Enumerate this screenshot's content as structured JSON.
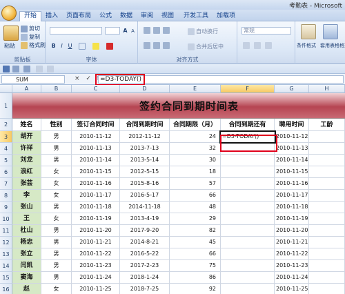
{
  "window": {
    "title": "考勤表 - Microsoft"
  },
  "tabs": [
    "开始",
    "插入",
    "页面布局",
    "公式",
    "数据",
    "审阅",
    "视图",
    "开发工具",
    "加载项"
  ],
  "ribbon": {
    "clipboard": {
      "paste": "粘贴",
      "cut": "剪切",
      "copy": "复制",
      "format_painter": "格式刷",
      "label": "剪贴板"
    },
    "font": {
      "label": "字体",
      "bold": "B",
      "italic": "I",
      "underline": "U",
      "grow": "A",
      "shrink": "A"
    },
    "alignment": {
      "label": "对齐方式",
      "wrap": "自动换行",
      "merge": "合并后居中"
    },
    "number": {
      "format": "常规"
    },
    "styles": {
      "conditional": "条件格式",
      "table": "套用表格格式"
    }
  },
  "formula_bar": {
    "name_box": "SUM",
    "fx": "× ✓ fx",
    "formula": "=D3-TODAY()"
  },
  "columns": [
    "A",
    "B",
    "C",
    "D",
    "E",
    "F",
    "G",
    "H"
  ],
  "sheet_title": "签约合同到期时间表",
  "headers": [
    "姓名",
    "性别",
    "签订合同时间",
    "合同到期时间",
    "合同期限（月）",
    "合同到期还有",
    "聘用时间",
    "工龄"
  ],
  "rows": [
    {
      "row": "3",
      "name": "胡开",
      "sex": "男",
      "sign": "2010-11-12",
      "expire": "2012-11-12",
      "term": "24",
      "remain": "=D3-TODAY()",
      "hire": "2010-11-12"
    },
    {
      "row": "4",
      "name": "许祥",
      "sex": "男",
      "sign": "2010-11-13",
      "expire": "2013-7-13",
      "term": "32",
      "remain": "",
      "hire": "2010-11-13"
    },
    {
      "row": "5",
      "name": "刘龙",
      "sex": "男",
      "sign": "2010-11-14",
      "expire": "2013-5-14",
      "term": "30",
      "remain": "",
      "hire": "2010-11-14"
    },
    {
      "row": "6",
      "name": "浪红",
      "sex": "女",
      "sign": "2010-11-15",
      "expire": "2012-5-15",
      "term": "18",
      "remain": "",
      "hire": "2010-11-15"
    },
    {
      "row": "7",
      "name": "张芸",
      "sex": "女",
      "sign": "2010-11-16",
      "expire": "2015-8-16",
      "term": "57",
      "remain": "",
      "hire": "2010-11-16"
    },
    {
      "row": "8",
      "name": "李",
      "sex": "女",
      "sign": "2010-11-17",
      "expire": "2016-5-17",
      "term": "66",
      "remain": "",
      "hire": "2010-11-17"
    },
    {
      "row": "9",
      "name": "张山",
      "sex": "男",
      "sign": "2010-11-18",
      "expire": "2014-11-18",
      "term": "48",
      "remain": "",
      "hire": "2010-11-18"
    },
    {
      "row": "10",
      "name": "王",
      "sex": "女",
      "sign": "2010-11-19",
      "expire": "2013-4-19",
      "term": "29",
      "remain": "",
      "hire": "2010-11-19"
    },
    {
      "row": "11",
      "name": "杜山",
      "sex": "男",
      "sign": "2010-11-20",
      "expire": "2017-9-20",
      "term": "82",
      "remain": "",
      "hire": "2010-11-20"
    },
    {
      "row": "12",
      "name": "杨忠",
      "sex": "男",
      "sign": "2010-11-21",
      "expire": "2014-8-21",
      "term": "45",
      "remain": "",
      "hire": "2010-11-21"
    },
    {
      "row": "13",
      "name": "张立",
      "sex": "男",
      "sign": "2010-11-22",
      "expire": "2016-5-22",
      "term": "66",
      "remain": "",
      "hire": "2010-11-22"
    },
    {
      "row": "14",
      "name": "闫凯",
      "sex": "男",
      "sign": "2010-11-23",
      "expire": "2017-2-23",
      "term": "75",
      "remain": "",
      "hire": "2010-11-23"
    },
    {
      "row": "15",
      "name": "窦海",
      "sex": "男",
      "sign": "2010-11-24",
      "expire": "2018-1-24",
      "term": "86",
      "remain": "",
      "hire": "2010-11-24"
    },
    {
      "row": "16",
      "name": "赵",
      "sex": "女",
      "sign": "2010-11-25",
      "expire": "2018-7-25",
      "term": "92",
      "remain": "",
      "hire": "2010-11-25"
    }
  ]
}
